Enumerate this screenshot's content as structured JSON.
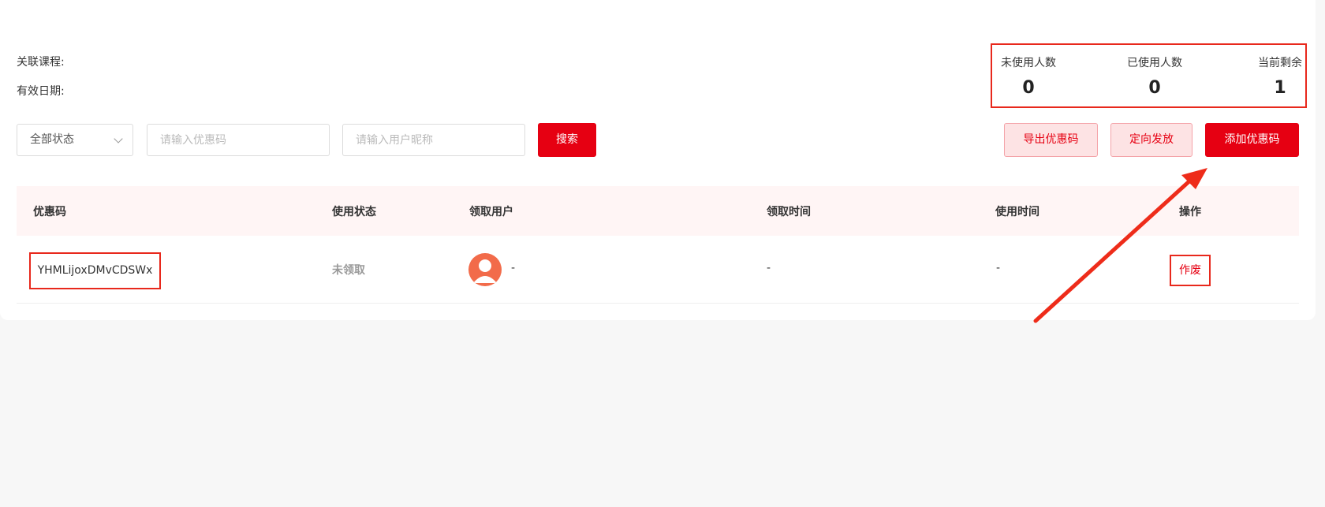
{
  "info": {
    "course_label": "关联课程:",
    "date_label": "有效日期:"
  },
  "stats": {
    "unused_label": "未使用人数",
    "unused_value": "0",
    "used_label": "已使用人数",
    "used_value": "0",
    "remaining_label": "当前剩余",
    "remaining_value": "1"
  },
  "filters": {
    "status_select": "全部状态",
    "code_placeholder": "请输入优惠码",
    "user_placeholder": "请输入用户昵称",
    "search_label": "搜索"
  },
  "actions": {
    "export_label": "导出优惠码",
    "target_label": "定向发放",
    "add_label": "添加优惠码"
  },
  "table": {
    "headers": {
      "code": "优惠码",
      "status": "使用状态",
      "user": "领取用户",
      "receive_time": "领取时间",
      "use_time": "使用时间",
      "action": "操作"
    },
    "rows": [
      {
        "code": "YHMLijoxDMvCDSWx",
        "status": "未领取",
        "user": "-",
        "receive_time": "-",
        "use_time": "-",
        "action": "作废"
      }
    ]
  },
  "colors": {
    "accent": "#e60012",
    "highlight": "#e8281c",
    "avatar": "#f26b4a",
    "header_bg": "#fff5f5"
  },
  "icons": {
    "avatar": "user-avatar-icon",
    "select_arrow": "chevron-down-icon",
    "annotation": "arrow-annotation-icon"
  }
}
